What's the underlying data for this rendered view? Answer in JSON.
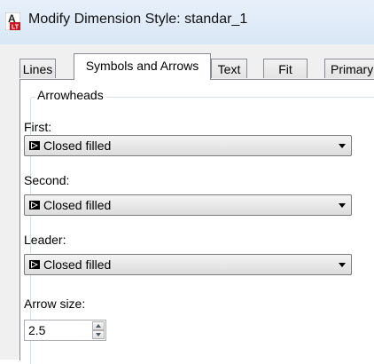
{
  "window": {
    "title": "Modify Dimension Style: standar_1",
    "app_icon": "autocad-lt-icon"
  },
  "tabs": [
    {
      "label": "Lines",
      "active": false
    },
    {
      "label": "Symbols and Arrows",
      "active": true
    },
    {
      "label": "Text",
      "active": false
    },
    {
      "label": "Fit",
      "active": false
    },
    {
      "label": "Primary",
      "active": false
    }
  ],
  "arrowheads": {
    "group_title": "Arrowheads",
    "first_label": "First:",
    "first_value": "Closed filled",
    "second_label": "Second:",
    "second_value": "Closed filled",
    "leader_label": "Leader:",
    "leader_value": "Closed filled",
    "item_icon": "closed-filled-arrow-icon"
  },
  "arrow_size": {
    "label": "Arrow size:",
    "value": "2.5"
  },
  "colors": {
    "titlebar": "#dce9f7",
    "tab_border": "#898c95",
    "panel_bg": "#ffffff",
    "dialog_bg": "#f0f0f0"
  }
}
